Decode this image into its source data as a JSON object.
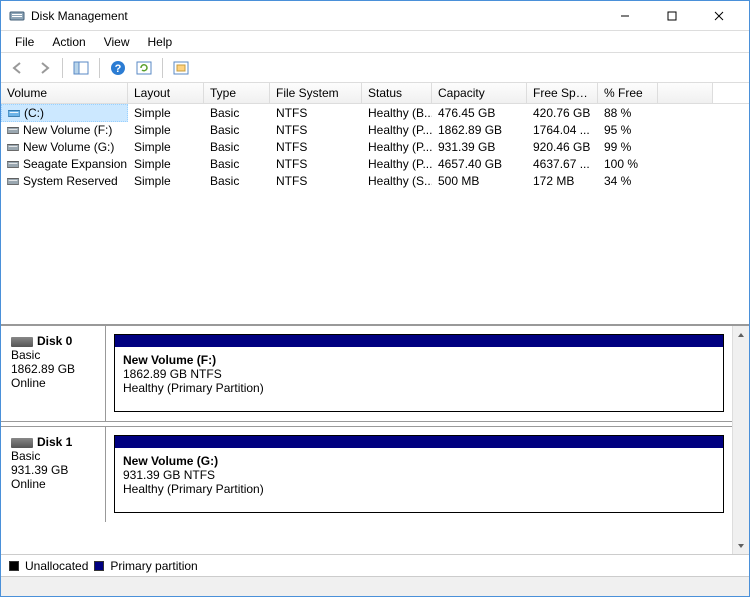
{
  "window": {
    "title": "Disk Management"
  },
  "menu": {
    "file": "File",
    "action": "Action",
    "view": "View",
    "help": "Help"
  },
  "columns": [
    "Volume",
    "Layout",
    "Type",
    "File System",
    "Status",
    "Capacity",
    "Free Spa...",
    "% Free"
  ],
  "volumes": [
    {
      "name": "(C:)",
      "layout": "Simple",
      "type": "Basic",
      "fs": "NTFS",
      "status": "Healthy (B...",
      "capacity": "476.45 GB",
      "free": "420.76 GB",
      "pct": "88 %",
      "selected": true,
      "icon": "primary"
    },
    {
      "name": "New Volume (F:)",
      "layout": "Simple",
      "type": "Basic",
      "fs": "NTFS",
      "status": "Healthy (P...",
      "capacity": "1862.89 GB",
      "free": "1764.04 ...",
      "pct": "95 %",
      "selected": false,
      "icon": "drive"
    },
    {
      "name": "New Volume (G:)",
      "layout": "Simple",
      "type": "Basic",
      "fs": "NTFS",
      "status": "Healthy (P...",
      "capacity": "931.39 GB",
      "free": "920.46 GB",
      "pct": "99 %",
      "selected": false,
      "icon": "drive"
    },
    {
      "name": "Seagate Expansion...",
      "layout": "Simple",
      "type": "Basic",
      "fs": "NTFS",
      "status": "Healthy (P...",
      "capacity": "4657.40 GB",
      "free": "4637.67 ...",
      "pct": "100 %",
      "selected": false,
      "icon": "drive"
    },
    {
      "name": "System Reserved",
      "layout": "Simple",
      "type": "Basic",
      "fs": "NTFS",
      "status": "Healthy (S...",
      "capacity": "500 MB",
      "free": "172 MB",
      "pct": "34 %",
      "selected": false,
      "icon": "drive"
    }
  ],
  "disks": [
    {
      "name": "Disk 0",
      "type": "Basic",
      "size": "1862.89 GB",
      "state": "Online",
      "partition": {
        "title": "New Volume  (F:)",
        "line1": "1862.89 GB NTFS",
        "line2": "Healthy (Primary Partition)"
      }
    },
    {
      "name": "Disk 1",
      "type": "Basic",
      "size": "931.39 GB",
      "state": "Online",
      "partition": {
        "title": "New Volume  (G:)",
        "line1": "931.39 GB NTFS",
        "line2": "Healthy (Primary Partition)"
      }
    }
  ],
  "legend": {
    "unallocated": "Unallocated",
    "primary": "Primary partition"
  }
}
